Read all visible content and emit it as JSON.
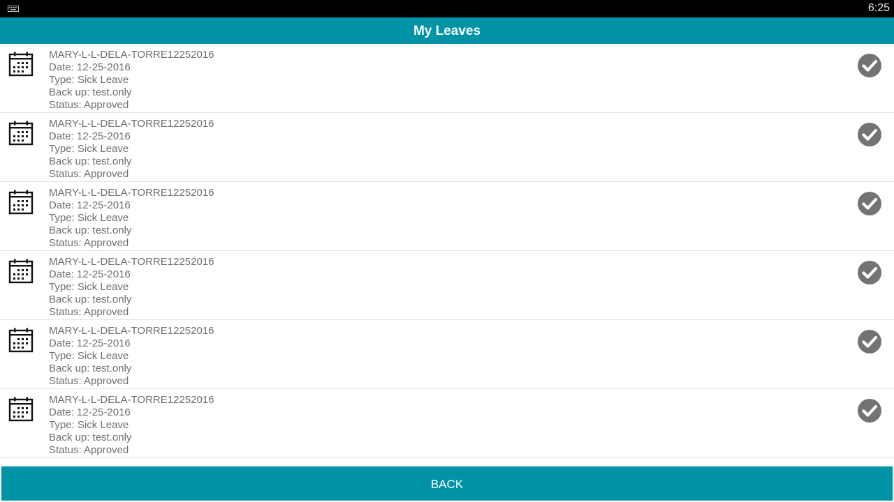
{
  "status_bar": {
    "clock": "6:25",
    "left_icon": "keyboard-icon"
  },
  "header": {
    "title": "My Leaves"
  },
  "leaves": [
    {
      "id": "MARY-L-L-DELA-TORRE12252016",
      "date": "Date: 12-25-2016",
      "type": "Type: Sick Leave",
      "backup": "Back up: test.only",
      "status": "Status: Approved",
      "icon": "calendar-icon",
      "status_icon": "check-circle-icon"
    },
    {
      "id": "MARY-L-L-DELA-TORRE12252016",
      "date": "Date: 12-25-2016",
      "type": "Type: Sick Leave",
      "backup": "Back up: test.only",
      "status": "Status: Approved",
      "icon": "calendar-icon",
      "status_icon": "check-circle-icon"
    },
    {
      "id": "MARY-L-L-DELA-TORRE12252016",
      "date": "Date: 12-25-2016",
      "type": "Type: Sick Leave",
      "backup": "Back up: test.only",
      "status": "Status: Approved",
      "icon": "calendar-icon",
      "status_icon": "check-circle-icon"
    },
    {
      "id": "MARY-L-L-DELA-TORRE12252016",
      "date": "Date: 12-25-2016",
      "type": "Type: Sick Leave",
      "backup": "Back up: test.only",
      "status": "Status: Approved",
      "icon": "calendar-icon",
      "status_icon": "check-circle-icon"
    },
    {
      "id": "MARY-L-L-DELA-TORRE12252016",
      "date": "Date: 12-25-2016",
      "type": "Type: Sick Leave",
      "backup": "Back up: test.only",
      "status": "Status: Approved",
      "icon": "calendar-icon",
      "status_icon": "check-circle-icon"
    },
    {
      "id": "MARY-L-L-DELA-TORRE12252016",
      "date": "Date: 12-25-2016",
      "type": "Type: Sick Leave",
      "backup": "Back up: test.only",
      "status": "Status: Approved",
      "icon": "calendar-icon",
      "status_icon": "check-circle-icon"
    }
  ],
  "footer": {
    "back_label": "BACK"
  },
  "colors": {
    "accent": "#0093a6",
    "text_secondary": "#6e6e6e",
    "approved_icon": "#737373"
  }
}
